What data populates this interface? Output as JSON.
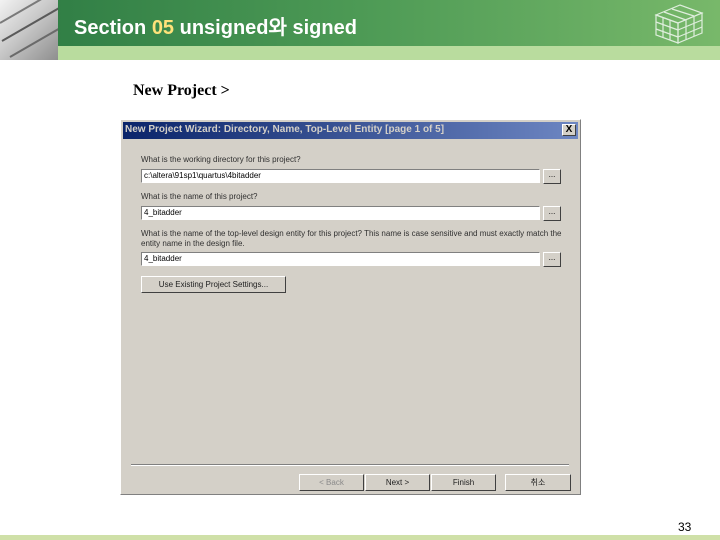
{
  "slide": {
    "title_section": "Section",
    "title_number": "05",
    "title_rest": "unsigned와 signed",
    "subheading": "New Project  >",
    "page_number": "33"
  },
  "dialog": {
    "title": "New Project Wizard: Directory, Name, Top-Level Entity [page 1 of 5]",
    "close_label": "X",
    "q_directory": "What is the working directory for this project?",
    "directory_value": "c:\\altera\\91sp1\\quartus\\4bitadder",
    "q_name": "What is the name of this project?",
    "name_value": "4_bitadder",
    "q_toplevel": "What is the name of the top-level design entity for this project? This name is case sensitive and must exactly match the entity name in the design file.",
    "toplevel_value": "4_bitadder",
    "browse_label": "...",
    "use_existing_label": "Use Existing Project Settings...",
    "back_label": "< Back",
    "next_label": "Next >",
    "finish_label": "Finish",
    "cancel_label": "취소"
  }
}
